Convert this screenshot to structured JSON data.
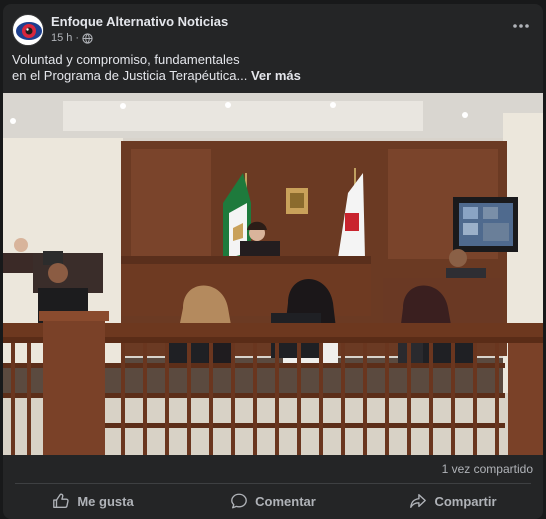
{
  "post": {
    "page_name": "Enfoque Alternativo Noticias",
    "time": "15 h",
    "separator": "·",
    "privacy_icon": "globe-icon",
    "text_line1": "Voluntad y compromiso, fundamentales",
    "text_line2": "en el Programa de Justicia Terapéutica...",
    "see_more": "Ver más",
    "photo_icon": "courtroom-photo"
  },
  "footer": {
    "shares": "1 vez compartido",
    "like_label": "Me gusta",
    "comment_label": "Comentar",
    "share_label": "Compartir"
  },
  "colors": {
    "background": "#18191a",
    "card": "#242526",
    "text_primary": "#e4e6eb",
    "text_secondary": "#b0b3b8",
    "divider": "#3e4042"
  }
}
